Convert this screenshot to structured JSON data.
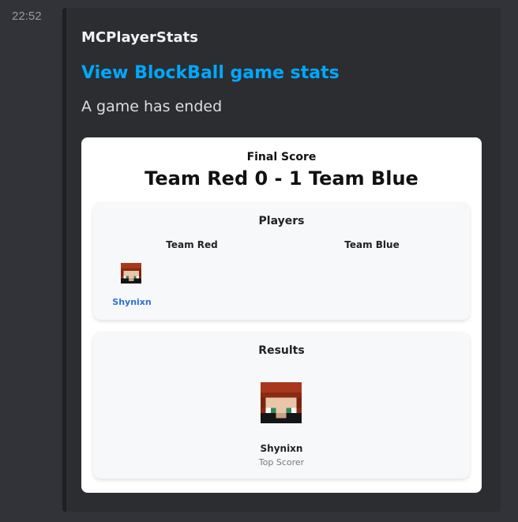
{
  "message": {
    "timestamp": "22:52",
    "author": "MCPlayerStats",
    "title": "View BlockBall game stats",
    "description": "A game has ended"
  },
  "card": {
    "final_score_label": "Final Score",
    "score_line": "Team Red 0 - 1 Team Blue",
    "players_panel": {
      "title": "Players",
      "team_red_label": "Team Red",
      "team_blue_label": "Team Blue",
      "team_red_players": [
        "Shynixn"
      ],
      "team_blue_players": []
    },
    "results_panel": {
      "title": "Results",
      "top_scorer_name": "Shynixn",
      "top_scorer_role": "Top Scorer"
    }
  },
  "colors": {
    "background": "#313338",
    "embed_background": "#2b2d31",
    "link": "#00a8fc",
    "player_link": "#2e6fd6"
  },
  "icons": {
    "avatar": "minecraft-player-head"
  }
}
